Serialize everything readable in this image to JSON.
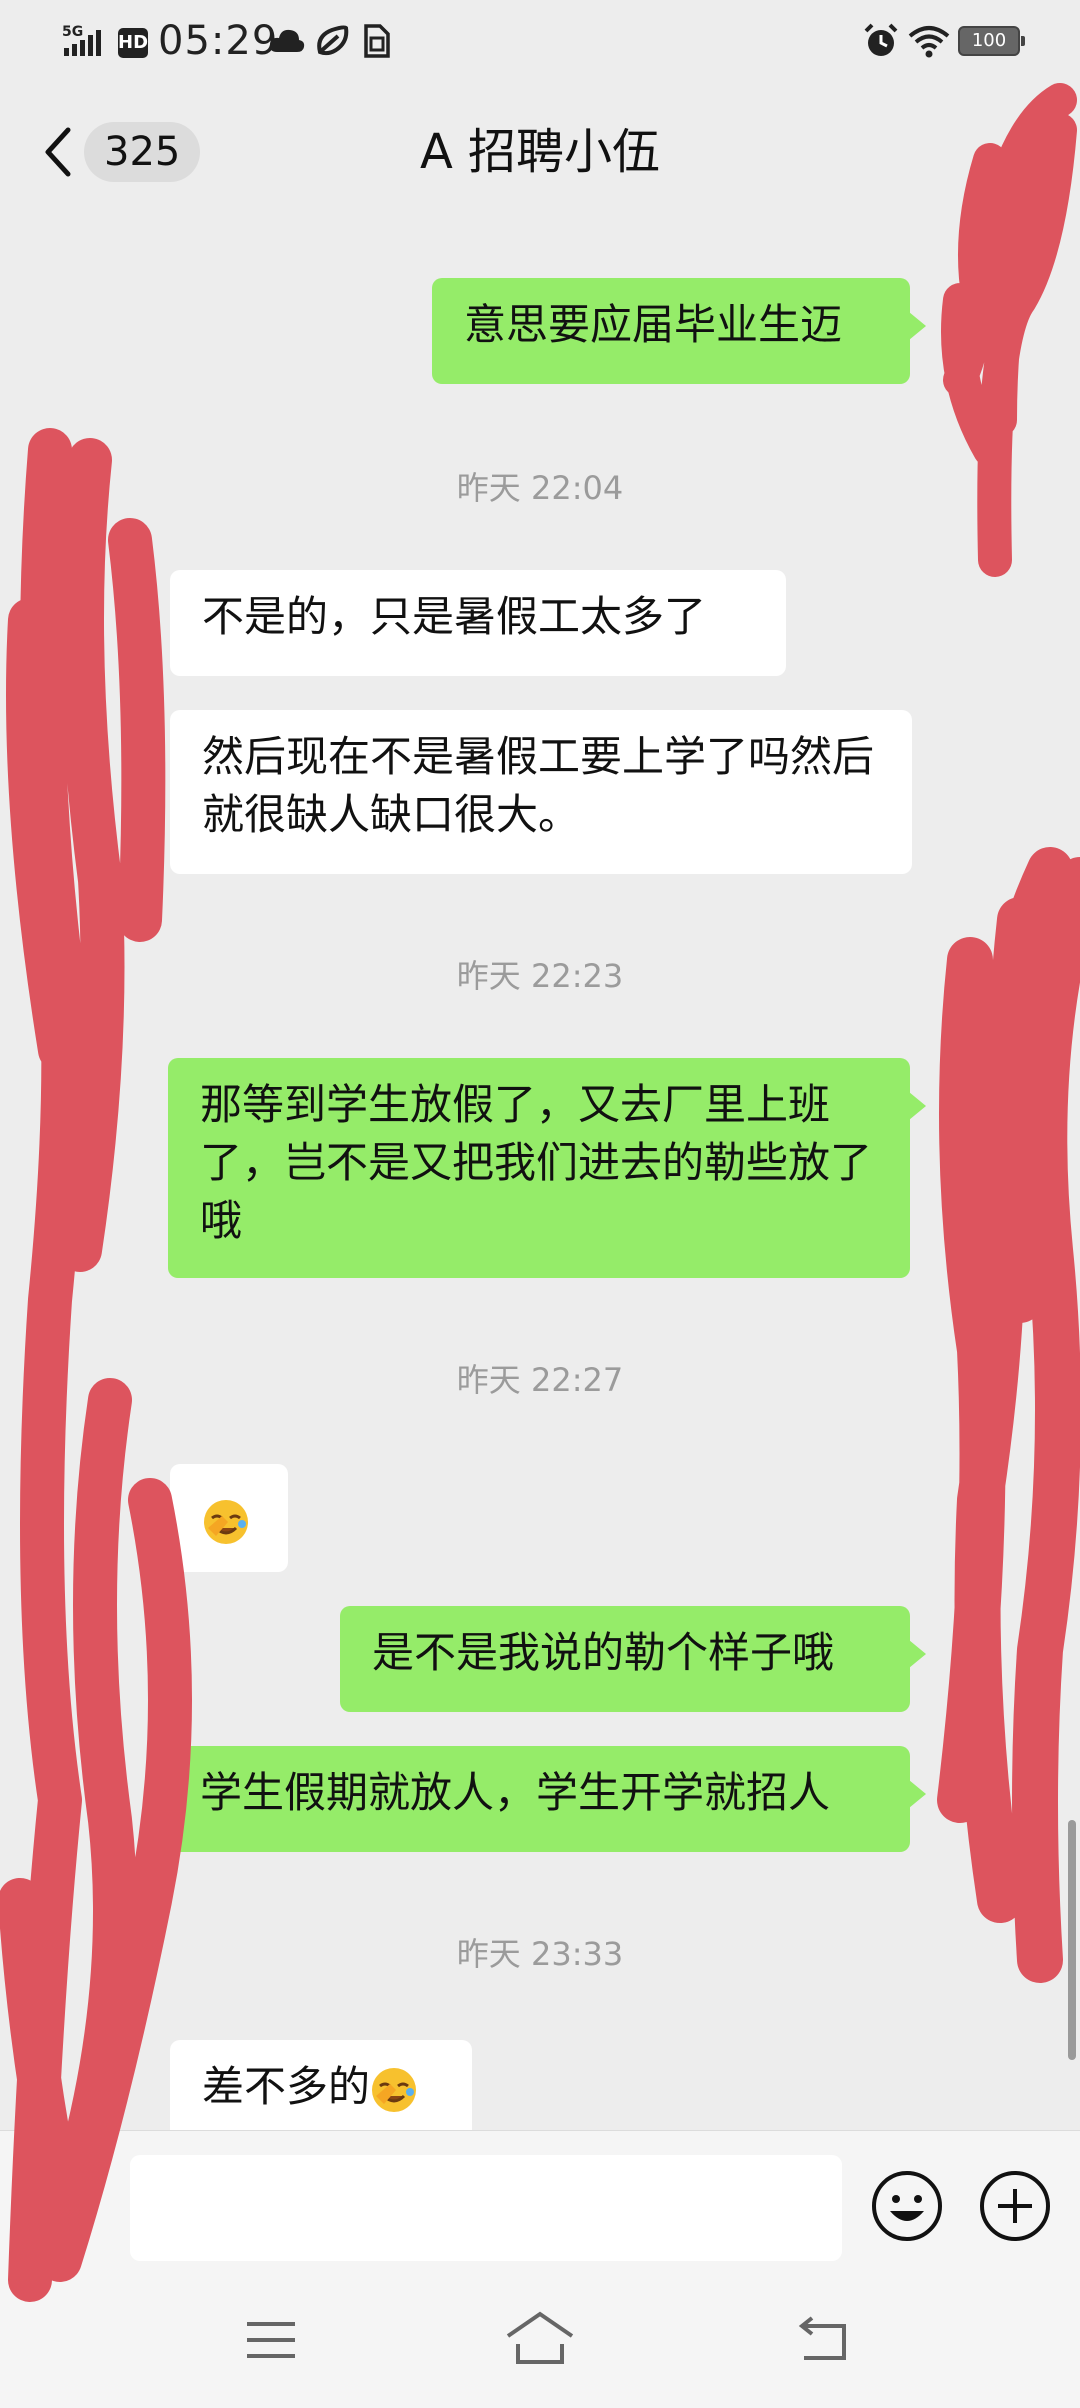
{
  "status_bar": {
    "network": "5G",
    "hd": "HD",
    "time": "05:29",
    "battery": "100"
  },
  "header": {
    "unread_count": "325",
    "title": "A 招聘小伍",
    "back_icon": "chevron-left-icon",
    "more_icon": "more-dots-icon"
  },
  "messages": [
    {
      "type": "out",
      "text": "意思要应届毕业生迈"
    },
    {
      "type": "time",
      "text": "昨天 22:04"
    },
    {
      "type": "in",
      "text": "不是的，只是暑假工太多了"
    },
    {
      "type": "in",
      "text": "然后现在不是暑假工要上学了吗然后就很缺人缺口很大。"
    },
    {
      "type": "time",
      "text": "昨天 22:23"
    },
    {
      "type": "out",
      "text": "那等到学生放假了，又去厂里上班了，岂不是又把我们进去的勒些放了哦"
    },
    {
      "type": "time",
      "text": "昨天 22:27"
    },
    {
      "type": "in",
      "emoji": "facepalm-emoji"
    },
    {
      "type": "out",
      "text": "是不是我说的勒个样子哦"
    },
    {
      "type": "out",
      "text": "学生假期就放人，学生开学就招人"
    },
    {
      "type": "time",
      "text": "昨天 23:33"
    },
    {
      "type": "in",
      "text": "差不多的",
      "emoji": "facepalm-emoji"
    }
  ],
  "input_bar": {
    "value": "",
    "placeholder": "",
    "voice_icon": "voice-icon",
    "emoji_icon": "smiley-icon",
    "plus_icon": "plus-circle-icon"
  },
  "nav_bar": {
    "menu_icon": "menu-icon",
    "home_icon": "home-icon",
    "back_icon": "back-arrow-icon"
  },
  "colors": {
    "out_bubble": "#95ec69",
    "in_bubble": "#ffffff",
    "background": "#ededed",
    "scribble": "#dd545e"
  }
}
